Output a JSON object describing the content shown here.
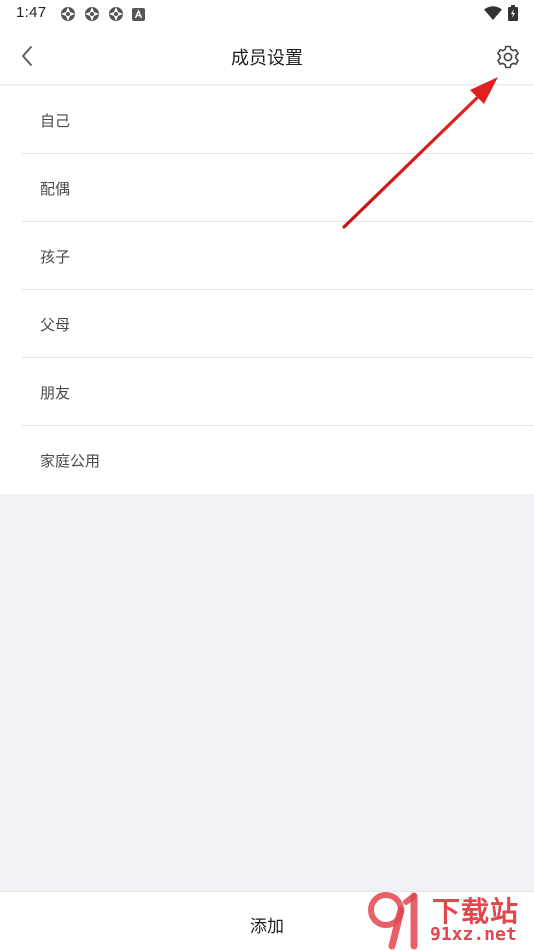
{
  "status_bar": {
    "time": "1:47",
    "left_icons": [
      "aperture-icon",
      "aperture-icon",
      "aperture-icon",
      "a-box-icon"
    ],
    "right_icons": [
      "wifi-icon",
      "battery-charging-icon"
    ]
  },
  "header": {
    "title": "成员设置",
    "back_icon": "chevron-left-icon",
    "settings_icon": "gear-icon"
  },
  "members": [
    {
      "label": "自己"
    },
    {
      "label": "配偶"
    },
    {
      "label": "孩子"
    },
    {
      "label": "父母"
    },
    {
      "label": "朋友"
    },
    {
      "label": "家庭公用"
    }
  ],
  "bottom": {
    "add_label": "添加"
  },
  "annotation": {
    "color": "#e02020"
  },
  "watermark": {
    "text": "下载站",
    "url": "91xz.net",
    "color": "#e2464e"
  }
}
